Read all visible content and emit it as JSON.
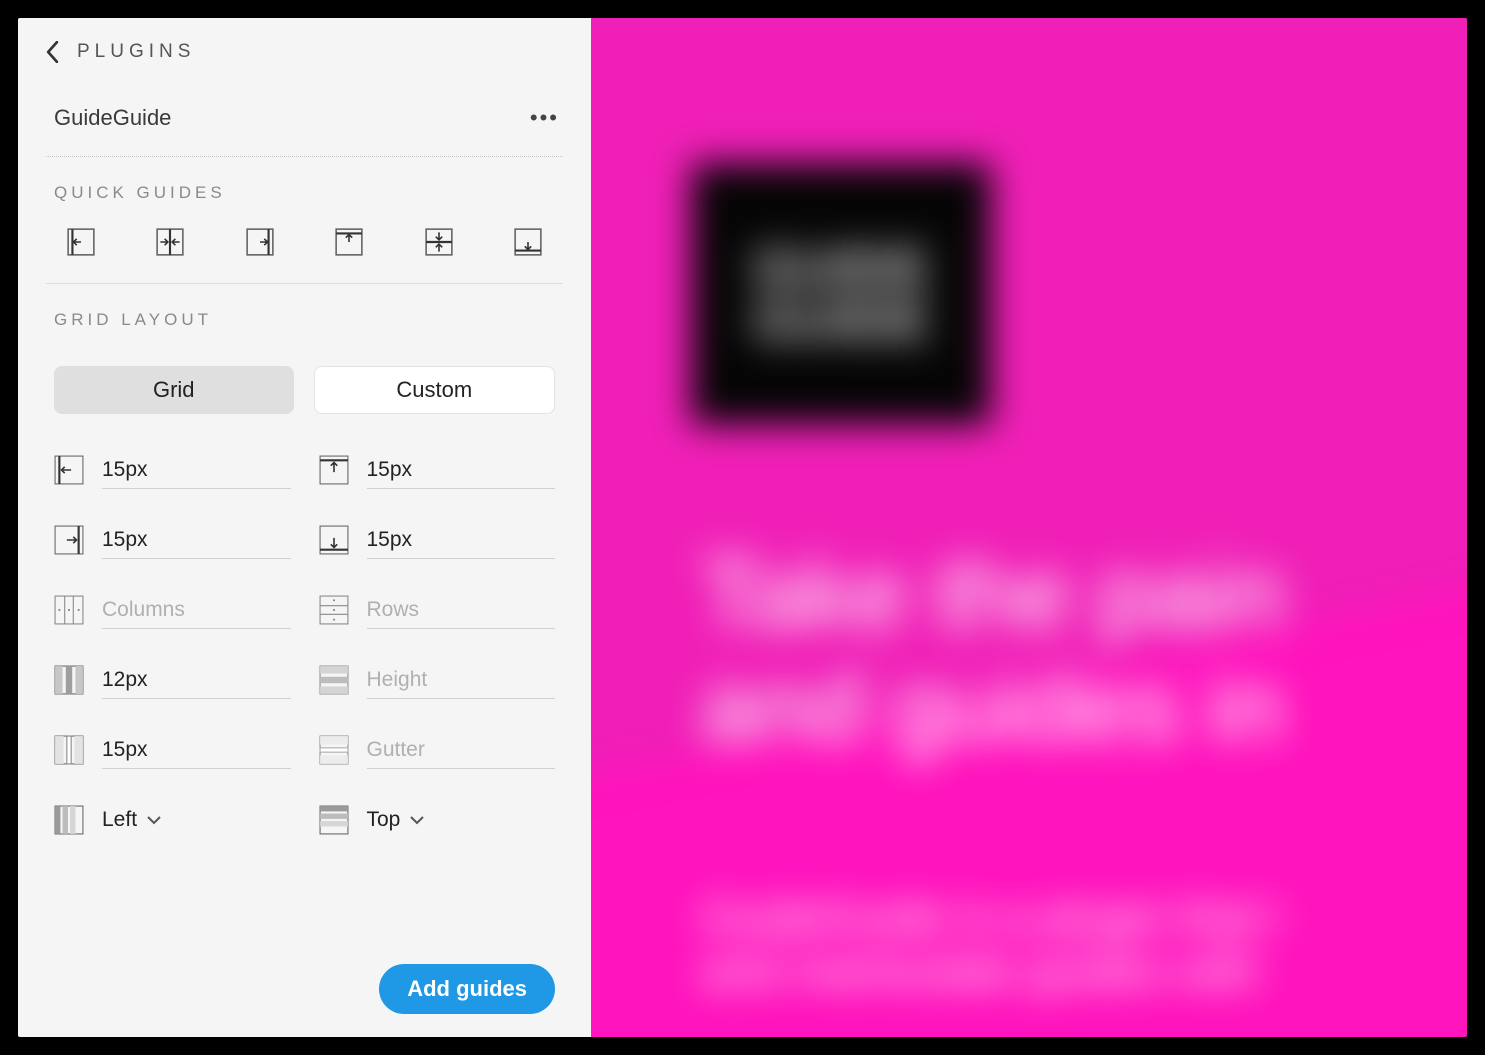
{
  "nav": {
    "back_label": "PLUGINS"
  },
  "plugin": {
    "name": "GuideGuide"
  },
  "sections": {
    "quick_guides": "QUICK GUIDES",
    "grid_layout": "GRID LAYOUT"
  },
  "quick_guides": {
    "names": [
      "guide-left",
      "guide-h-center",
      "guide-right",
      "guide-top",
      "guide-v-center",
      "guide-bottom"
    ]
  },
  "toggle": {
    "grid": "Grid",
    "custom": "Custom"
  },
  "fields": {
    "margin_left": {
      "value": "15px"
    },
    "margin_top": {
      "value": "15px"
    },
    "margin_right": {
      "value": "15px"
    },
    "margin_bottom": {
      "value": "15px"
    },
    "columns": {
      "placeholder": "Columns"
    },
    "rows": {
      "placeholder": "Rows"
    },
    "col_width": {
      "value": "12px"
    },
    "row_height": {
      "placeholder": "Height"
    },
    "col_gutter": {
      "value": "15px"
    },
    "row_gutter": {
      "placeholder": "Gutter"
    },
    "h_align": {
      "value": "Left"
    },
    "v_align": {
      "value": "Top"
    }
  },
  "footer": {
    "add_guides": "Add guides"
  },
  "canvas": {
    "logo_line1": "GUIDE",
    "logo_line2": "GUIDE",
    "heading_line1": "Take the pain",
    "heading_line2": "and guides in",
    "sub_line1": "GuideGuide is a plugin that l",
    "sub_line2": "and manioulate guides with"
  },
  "colors": {
    "accent": "#1f98e5",
    "canvas_bg": "#ff14bd"
  }
}
